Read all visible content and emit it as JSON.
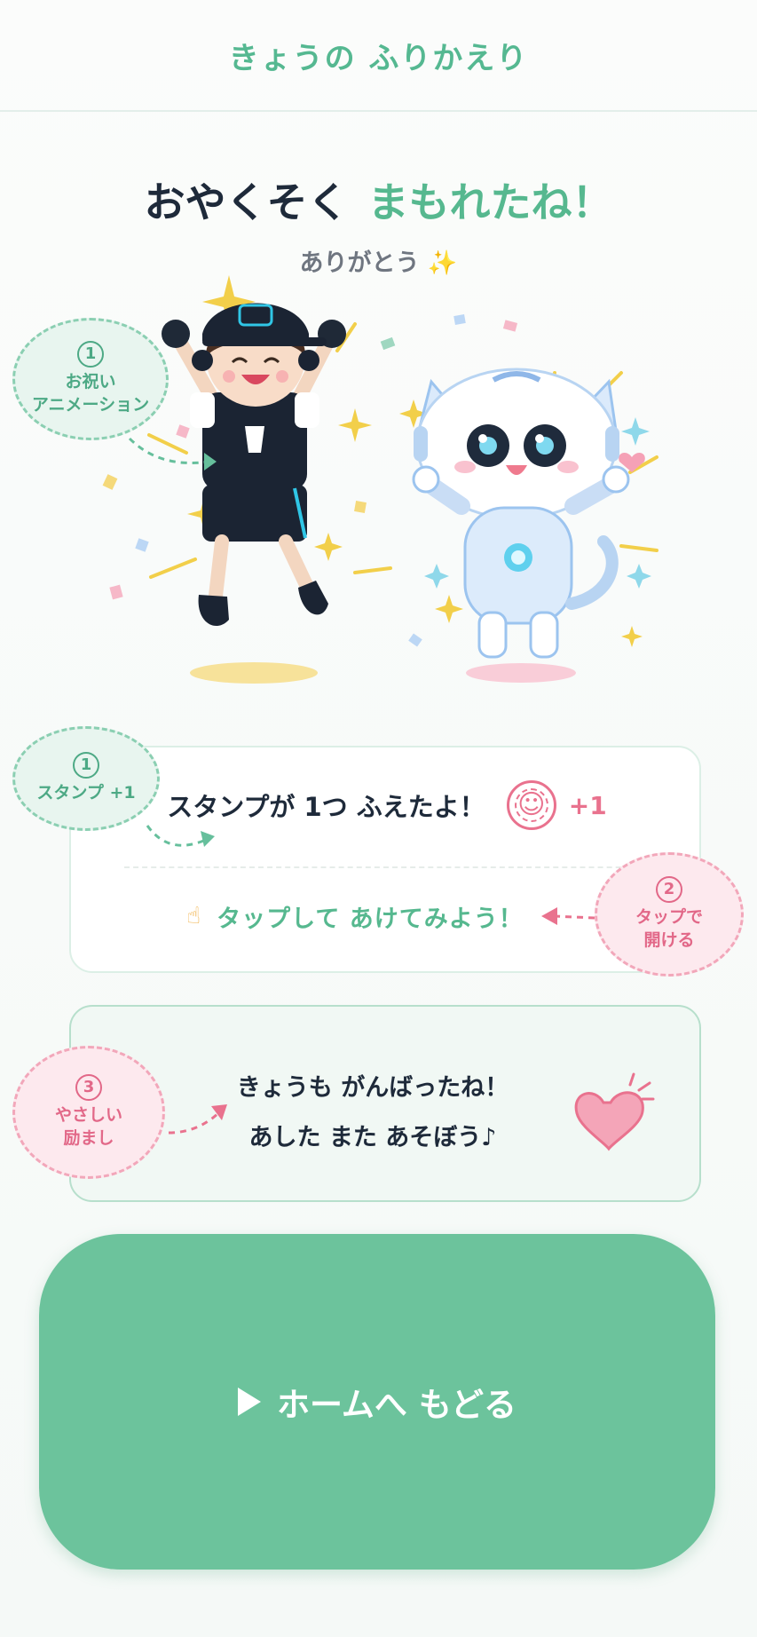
{
  "header": {
    "title": "きょうの ふりかえり"
  },
  "headline": {
    "part1": "おやくそく",
    "part2": "まもれたね！"
  },
  "subtitle": {
    "text": "ありがとう",
    "sparkle": "✨"
  },
  "annotations": {
    "animation": {
      "number": "1",
      "label": "お祝い\nアニメーション"
    },
    "stamp": {
      "number": "1",
      "label": "スタンプ +1"
    },
    "tap": {
      "number": "2",
      "label": "タップで\n開ける"
    },
    "cheer": {
      "number": "3",
      "label": "やさしい\n励まし"
    }
  },
  "stamp_card": {
    "message": "スタンプが 1つ ふえたよ！",
    "badge": "+1",
    "tap_hint": "タップして あけてみよう！",
    "hand_icon": "pointing-hand-icon"
  },
  "cheer_card": {
    "line1": "きょうも がんばったね！",
    "line2": "あした また あそぼう♪"
  },
  "home_button": {
    "label": "ホームへ もどる"
  },
  "colors": {
    "green": "#56b88f",
    "pink": "#e9728e",
    "dark": "#1e2a3a",
    "button": "#6cc39c"
  }
}
